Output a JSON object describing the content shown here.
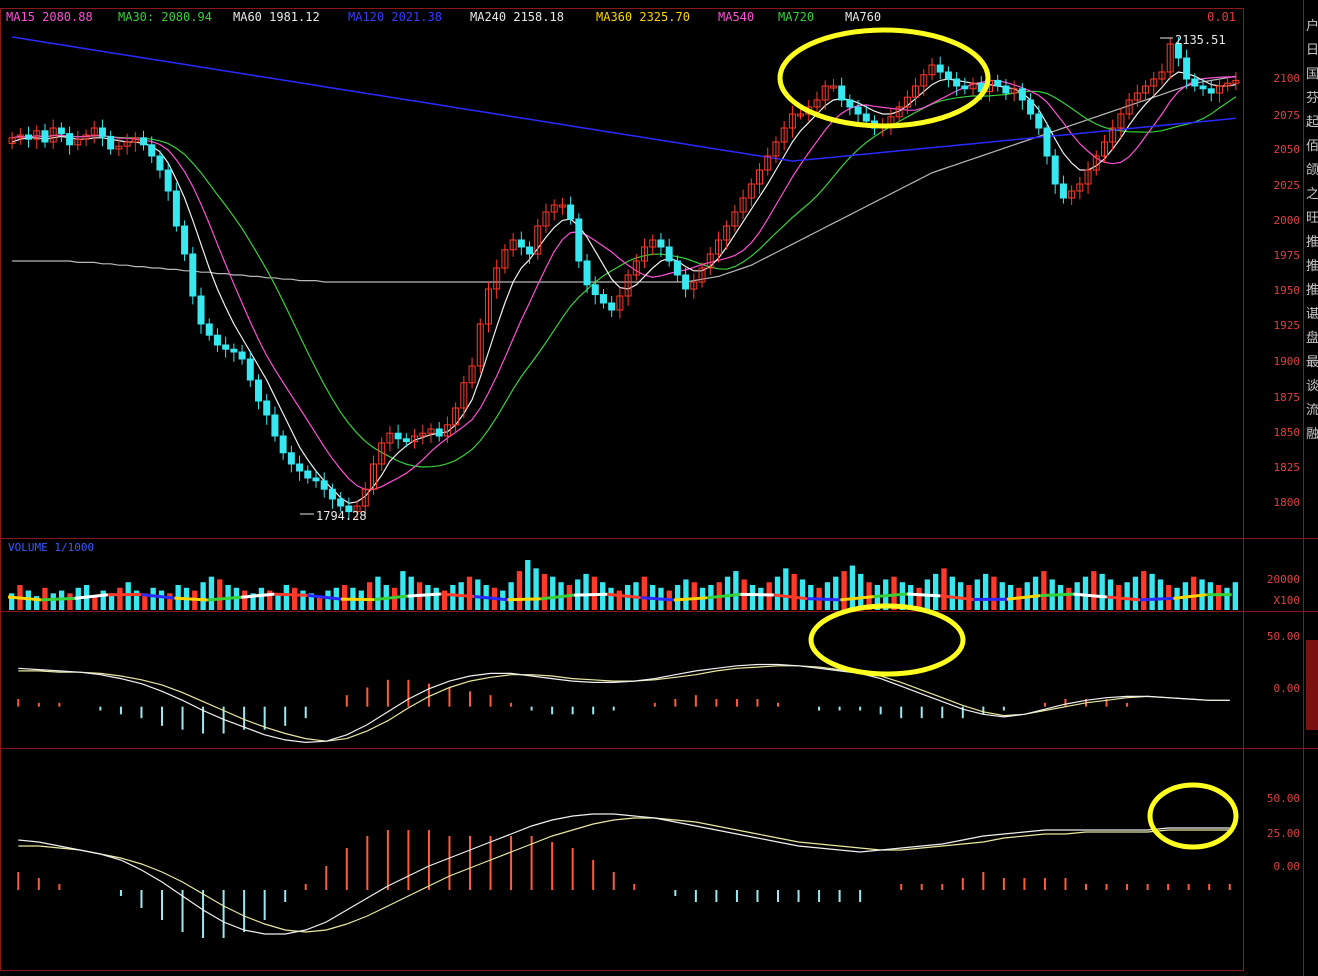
{
  "header": {
    "ma_labels": [
      {
        "text": "MA15  2080.88",
        "color": "#ff4fd8"
      },
      {
        "text": "MA30: 2080.94",
        "color": "#38d038"
      },
      {
        "text": "MA60  1981.12",
        "color": "#e8e8e8"
      },
      {
        "text": "MA120 2021.38",
        "color": "#3a3aff"
      },
      {
        "text": "MA240  2158.18",
        "color": "#e8e8e8"
      },
      {
        "text": "MA360  2325.70",
        "color": "#ffd400"
      },
      {
        "text": "MA540",
        "color": "#ff4fd8"
      },
      {
        "text": "MA720",
        "color": "#38d038"
      },
      {
        "text": "MA760",
        "color": "#e8e8e8"
      }
    ],
    "corner_value": "0.01"
  },
  "price_axis": [
    "2100",
    "2075",
    "2050",
    "2025",
    "2000",
    "1975",
    "1950",
    "1925",
    "1900",
    "1875",
    "1850",
    "1825",
    "1800"
  ],
  "volume_header": "VOLUME 1/1000",
  "volume_axis": [
    "20000",
    "X100"
  ],
  "macd1_axis": [
    "50.00",
    "0.00"
  ],
  "macd2_axis": [
    "50.00",
    "25.00",
    "0.00"
  ],
  "annotations": {
    "high": "2135.51",
    "low": "1794.28"
  },
  "side_panel": [
    "户",
    "日",
    "国",
    "芬",
    "起",
    "佰",
    "颌",
    "之",
    "旺",
    "推",
    "推",
    "推",
    "谌",
    "盘",
    "最",
    "谈",
    "流",
    "融"
  ],
  "colors": {
    "up": "#ff3a2a",
    "down": "#38e8f0",
    "bg": "#000000",
    "frame": "#8a1818",
    "highlight": "#ffff20"
  },
  "chart_data": [
    {
      "type": "candlestick",
      "title": "Price",
      "y_range": [
        1790,
        2140
      ],
      "x_count": 118,
      "close": [
        2063,
        2065,
        2062,
        2068,
        2060,
        2070,
        2066,
        2058,
        2062,
        2065,
        2070,
        2064,
        2055,
        2057,
        2060,
        2063,
        2058,
        2050,
        2040,
        2025,
        2000,
        1980,
        1950,
        1930,
        1922,
        1915,
        1912,
        1910,
        1905,
        1890,
        1875,
        1865,
        1850,
        1838,
        1830,
        1825,
        1820,
        1818,
        1812,
        1805,
        1800,
        1796,
        1800,
        1812,
        1830,
        1845,
        1852,
        1848,
        1846,
        1850,
        1852,
        1855,
        1850,
        1858,
        1870,
        1888,
        1900,
        1930,
        1955,
        1970,
        1983,
        1990,
        1985,
        1980,
        2000,
        2010,
        2015,
        2015,
        2005,
        1975,
        1958,
        1951,
        1945,
        1940,
        1950,
        1965,
        1975,
        1985,
        1990,
        1985,
        1975,
        1965,
        1955,
        1960,
        1970,
        1980,
        1990,
        2000,
        2010,
        2020,
        2030,
        2040,
        2050,
        2060,
        2070,
        2080,
        2080,
        2085,
        2090,
        2100,
        2100,
        2090,
        2085,
        2080,
        2075,
        2070,
        2072,
        2078,
        2085,
        2092,
        2100,
        2108,
        2115,
        2110,
        2105,
        2100,
        2098,
        2102,
        2096,
        2104,
        2100,
        2095,
        2098,
        2090,
        2080,
        2070,
        2050,
        2030,
        2020,
        2025,
        2030,
        2040,
        2050,
        2060,
        2070,
        2080,
        2090,
        2095,
        2100,
        2105,
        2110,
        2130,
        2120,
        2105,
        2100,
        2098,
        2095,
        2100,
        2102,
        2104
      ],
      "ma_short": [
        2060,
        2062,
        2063,
        2063,
        2062,
        2063,
        2064,
        2063,
        2062,
        2062,
        2063,
        2063,
        2062,
        2061,
        2060,
        2060,
        2059,
        2057,
        2053,
        2045,
        2033,
        2020,
        2004,
        1987,
        1970,
        1955,
        1942,
        1930,
        1920,
        1910,
        1900,
        1890,
        1878,
        1866,
        1854,
        1842,
        1833,
        1825,
        1818,
        1812,
        1806,
        1802,
        1803,
        1807,
        1814,
        1822,
        1832,
        1838,
        1843,
        1847,
        1849,
        1851,
        1852,
        1853,
        1858,
        1866,
        1876,
        1892,
        1910,
        1928,
        1945,
        1960,
        1970,
        1976,
        1984,
        1992,
        1999,
        2004,
        2005,
        2000,
        1992,
        1982,
        1972,
        1962,
        1956,
        1955,
        1958,
        1964,
        1970,
        1975,
        1977,
        1975,
        1971,
        1968,
        1968,
        1971,
        1977,
        1985,
        1994,
        2003,
        2012,
        2021,
        2030,
        2040,
        2050,
        2060,
        2068,
        2074,
        2080,
        2086,
        2090,
        2091,
        2090,
        2088,
        2085,
        2082,
        2080,
        2080,
        2082,
        2086,
        2091,
        2096,
        2101,
        2104,
        2105,
        2104,
        2103,
        2102,
        2101,
        2101,
        2100,
        2099,
        2098,
        2095,
        2090,
        2083,
        2073,
        2062,
        2052,
        2045,
        2040,
        2040,
        2043,
        2048,
        2055,
        2063,
        2072,
        2080,
        2087,
        2093,
        2099,
        2106,
        2110,
        2109,
        2107,
        2104,
        2101,
        2100,
        2100,
        2101
      ],
      "ma_long": [
        1975,
        1975,
        1975,
        1975,
        1975,
        1975,
        1975,
        1975,
        1974,
        1974,
        1974,
        1973,
        1973,
        1972,
        1972,
        1971,
        1971,
        1970,
        1970,
        1969,
        1969,
        1968,
        1968,
        1967,
        1967,
        1966,
        1966,
        1965,
        1965,
        1964,
        1964,
        1963,
        1963,
        1962,
        1962,
        1961,
        1961,
        1961,
        1960,
        1960,
        1960,
        1960,
        1960,
        1960,
        1960,
        1960,
        1960,
        1960,
        1960,
        1960,
        1960,
        1960,
        1960,
        1960,
        1960,
        1960,
        1960,
        1960,
        1960,
        1960,
        1960,
        1960,
        1960,
        1960,
        1960,
        1960,
        1960,
        1960,
        1960,
        1960,
        1960,
        1960,
        1960,
        1960,
        1960,
        1960,
        1960,
        1960,
        1960,
        1960,
        1960,
        1960,
        1960,
        1961,
        1962,
        1963,
        1964,
        1966,
        1968,
        1970,
        1972,
        1975,
        1978,
        1981,
        1984,
        1987,
        1990,
        1993,
        1996,
        1999,
        2002,
        2005,
        2008,
        2011,
        2014,
        2017,
        2020,
        2023,
        2026,
        2029,
        2032,
        2035,
        2038,
        2040,
        2042,
        2044,
        2046,
        2048,
        2050,
        2052,
        2054,
        2056,
        2058,
        2060,
        2062,
        2064,
        2066,
        2068,
        2070,
        2072,
        2074,
        2076,
        2078,
        2080,
        2082,
        2084,
        2086,
        2088,
        2090,
        2092,
        2094,
        2096,
        2098,
        2100,
        2102,
        2103,
        2104,
        2105,
        2106,
        2107
      ]
    },
    {
      "type": "bar",
      "title": "VOLUME",
      "values": [
        6,
        9,
        7,
        5,
        8,
        6,
        7,
        6,
        8,
        9,
        5,
        7,
        6,
        8,
        10,
        7,
        6,
        8,
        7,
        6,
        9,
        8,
        7,
        10,
        12,
        11,
        9,
        8,
        7,
        6,
        8,
        7,
        6,
        9,
        8,
        7,
        6,
        5,
        7,
        8,
        9,
        8,
        7,
        10,
        12,
        9,
        8,
        14,
        12,
        10,
        9,
        8,
        7,
        9,
        10,
        12,
        11,
        9,
        8,
        7,
        10,
        14,
        18,
        15,
        13,
        12,
        10,
        9,
        11,
        13,
        12,
        10,
        8,
        7,
        9,
        10,
        12,
        9,
        8,
        7,
        9,
        11,
        10,
        8,
        9,
        10,
        12,
        14,
        11,
        9,
        8,
        10,
        12,
        15,
        13,
        11,
        9,
        8,
        10,
        12,
        14,
        16,
        13,
        10,
        9,
        11,
        12,
        10,
        9,
        8,
        11,
        13,
        15,
        12,
        10,
        9,
        11,
        13,
        12,
        10,
        9,
        8,
        10,
        12,
        14,
        11,
        9,
        8,
        10,
        12,
        14,
        13,
        11,
        9,
        10,
        12,
        14,
        13,
        11,
        9,
        8,
        10,
        12,
        11,
        10,
        9,
        8,
        10
      ],
      "y_range": [
        0,
        25000
      ]
    },
    {
      "type": "line",
      "title": "MACD 1",
      "y_range": [
        -30,
        60
      ],
      "dif": [
        30,
        29,
        28,
        27,
        25,
        22,
        18,
        12,
        5,
        -3,
        -10,
        -16,
        -22,
        -26,
        -28,
        -27,
        -22,
        -14,
        -4,
        6,
        14,
        20,
        24,
        26,
        26,
        24,
        22,
        20,
        19,
        19,
        20,
        22,
        25,
        28,
        30,
        32,
        33,
        33,
        32,
        30,
        28,
        26,
        22,
        16,
        10,
        4,
        -2,
        -6,
        -8,
        -6,
        -2,
        2,
        5,
        7,
        8,
        8,
        7,
        6,
        5,
        5
      ],
      "dea": [
        28,
        28,
        27,
        27,
        26,
        24,
        21,
        17,
        11,
        4,
        -3,
        -10,
        -16,
        -21,
        -25,
        -27,
        -25,
        -19,
        -11,
        -1,
        8,
        15,
        20,
        23,
        25,
        25,
        24,
        22,
        21,
        20,
        20,
        21,
        23,
        25,
        28,
        30,
        31,
        32,
        32,
        31,
        29,
        27,
        24,
        19,
        13,
        7,
        1,
        -4,
        -7,
        -6,
        -3,
        0,
        3,
        5,
        7,
        8,
        7,
        6,
        5,
        5
      ],
      "hist": [
        2,
        1,
        1,
        0,
        -1,
        -2,
        -3,
        -5,
        -6,
        -7,
        -7,
        -6,
        -6,
        -5,
        -3,
        0,
        3,
        5,
        7,
        7,
        6,
        5,
        4,
        3,
        1,
        -1,
        -2,
        -2,
        -2,
        -1,
        0,
        1,
        2,
        3,
        2,
        2,
        2,
        1,
        0,
        -1,
        -1,
        -1,
        -2,
        -3,
        -3,
        -3,
        -3,
        -2,
        -1,
        0,
        1,
        2,
        2,
        2,
        1,
        0,
        0,
        0,
        0,
        0
      ]
    },
    {
      "type": "line",
      "title": "MACD 2",
      "y_range": [
        -25,
        55
      ],
      "dif": [
        25,
        24,
        22,
        20,
        18,
        15,
        10,
        4,
        -3,
        -10,
        -16,
        -20,
        -22,
        -22,
        -20,
        -16,
        -10,
        -4,
        2,
        7,
        12,
        16,
        20,
        24,
        28,
        32,
        35,
        37,
        38,
        38,
        37,
        36,
        34,
        32,
        30,
        28,
        26,
        24,
        22,
        21,
        20,
        19,
        20,
        21,
        22,
        23,
        25,
        27,
        28,
        29,
        30,
        30,
        30,
        30,
        30,
        30,
        31,
        31,
        31,
        31
      ],
      "dea": [
        22,
        22,
        21,
        20,
        18,
        16,
        13,
        9,
        4,
        -2,
        -8,
        -13,
        -17,
        -20,
        -21,
        -20,
        -17,
        -13,
        -8,
        -3,
        2,
        7,
        11,
        15,
        19,
        23,
        27,
        30,
        33,
        35,
        36,
        36,
        35,
        34,
        32,
        30,
        28,
        26,
        24,
        23,
        22,
        21,
        20,
        20,
        21,
        22,
        23,
        24,
        26,
        27,
        28,
        28,
        29,
        29,
        29,
        29,
        30,
        30,
        30,
        30
      ],
      "hist": [
        3,
        2,
        1,
        0,
        0,
        -1,
        -3,
        -5,
        -7,
        -8,
        -8,
        -7,
        -5,
        -2,
        1,
        4,
        7,
        9,
        10,
        10,
        10,
        9,
        9,
        9,
        9,
        9,
        8,
        7,
        5,
        3,
        1,
        0,
        -1,
        -2,
        -2,
        -2,
        -2,
        -2,
        -2,
        -2,
        -2,
        -2,
        0,
        1,
        1,
        1,
        2,
        3,
        2,
        2,
        2,
        2,
        1,
        1,
        1,
        1,
        1,
        1,
        1,
        1
      ]
    }
  ]
}
